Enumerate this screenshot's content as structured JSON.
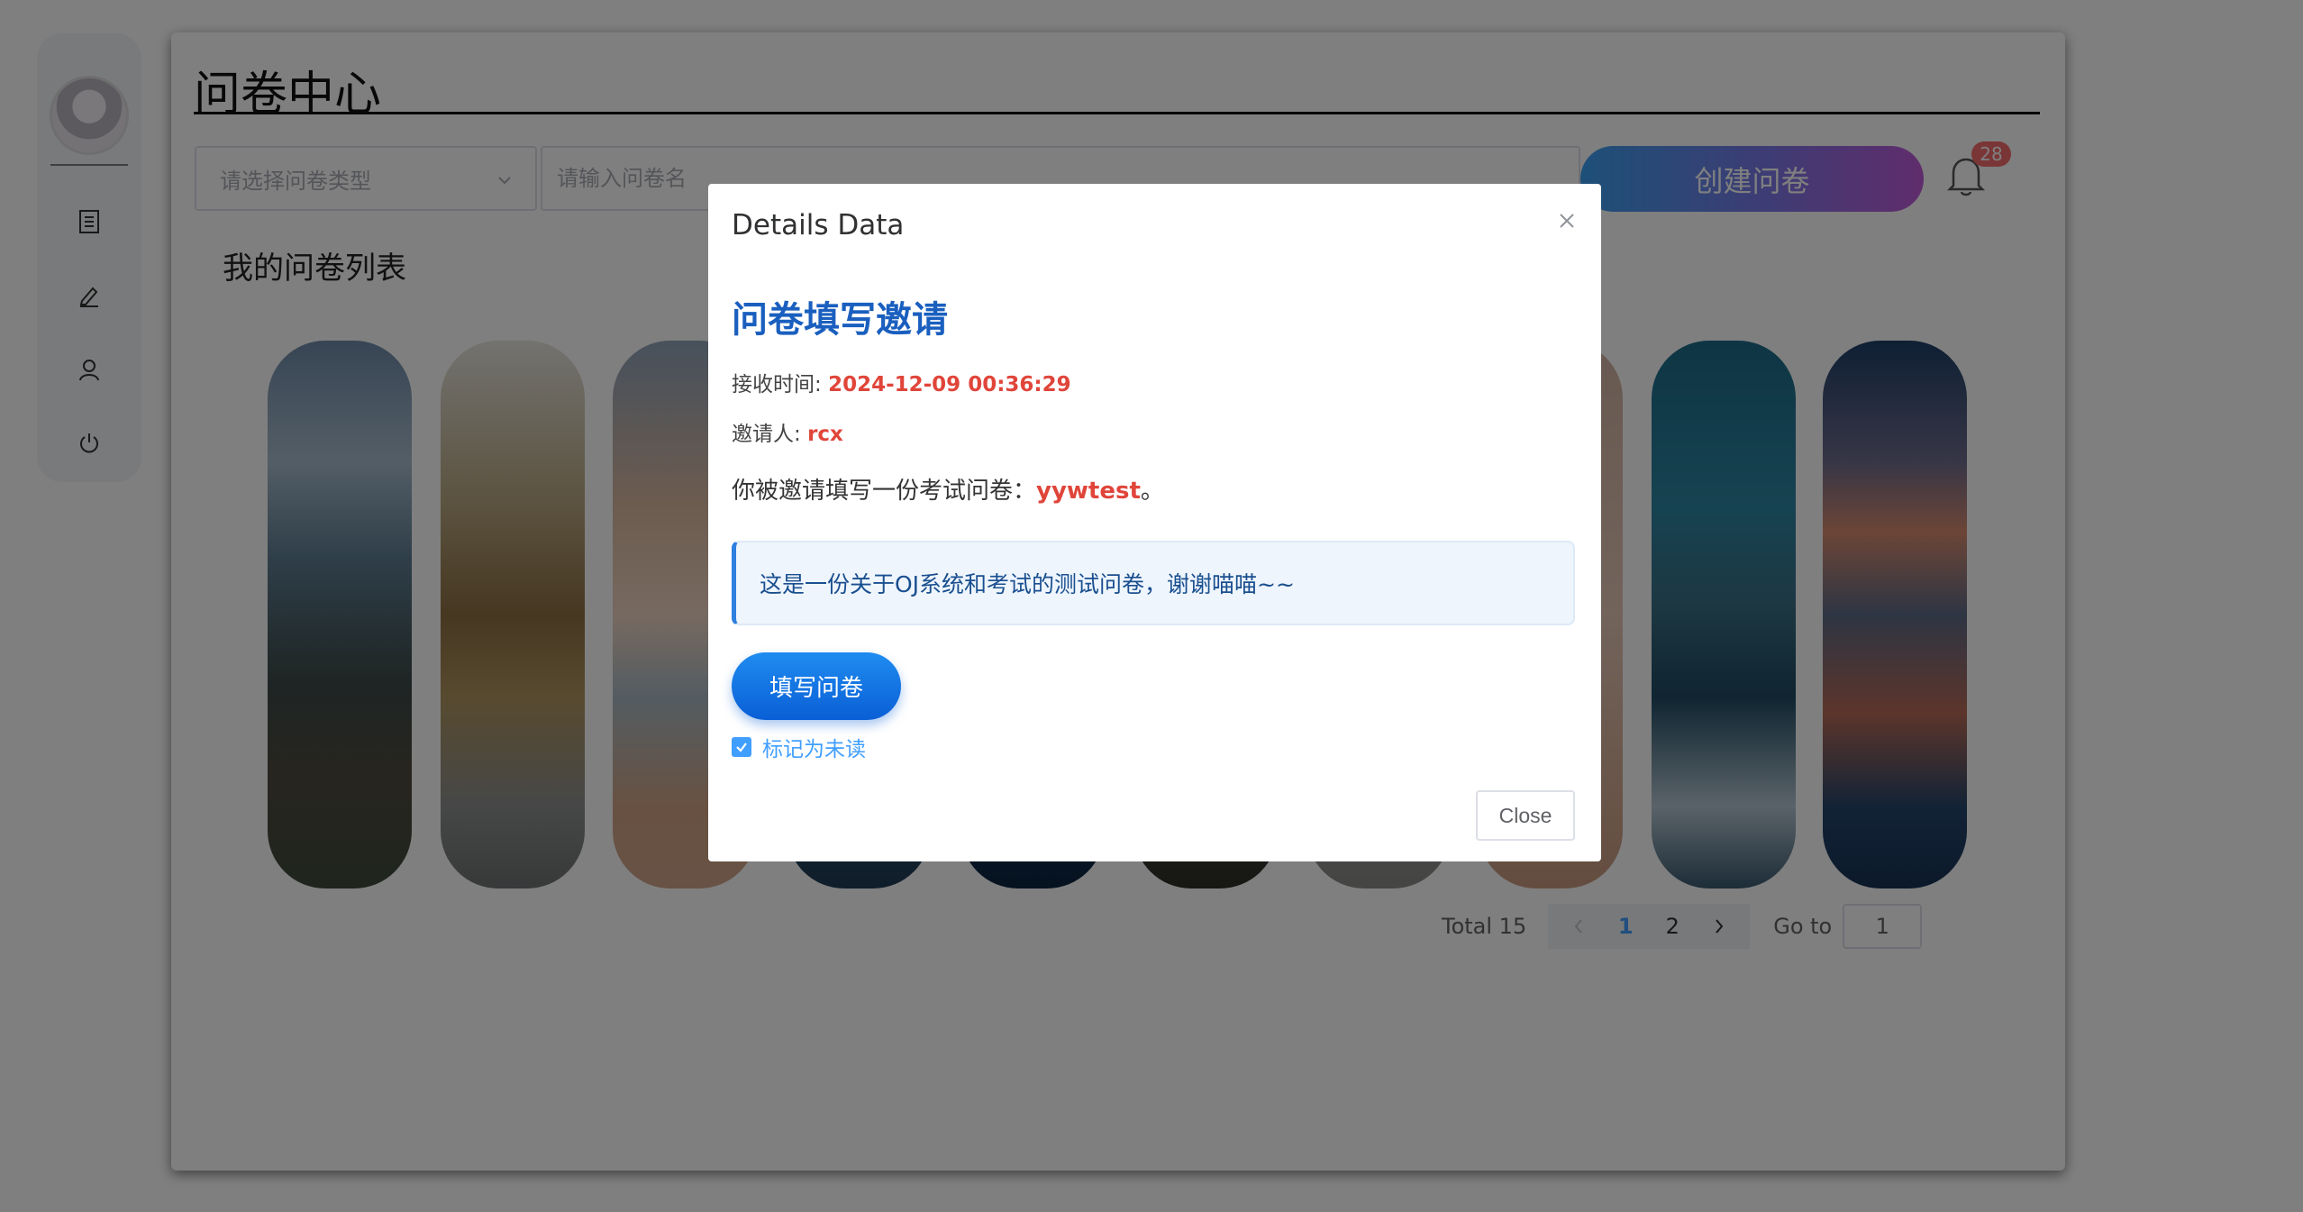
{
  "sidebar": {
    "avatar_alt": "avatar",
    "icons": [
      "document-icon",
      "edit-pen-icon",
      "user-icon",
      "power-icon"
    ]
  },
  "header": {
    "title": "问卷中心"
  },
  "filters": {
    "type_placeholder": "请选择问卷类型",
    "name_placeholder": "请输入问卷名",
    "create_label": "创建问卷"
  },
  "notifications": {
    "badge_count": "28"
  },
  "list": {
    "title": "我的问卷列表",
    "card_count": 10
  },
  "pagination": {
    "total_label": "Total 15",
    "pages": [
      "1",
      "2"
    ],
    "current_page": "1",
    "goto_label": "Go to",
    "goto_value": "1"
  },
  "dialog": {
    "title": "Details Data",
    "heading": "问卷填写邀请",
    "time_label": "接收时间: ",
    "time_value": "2024-12-09 00:36:29",
    "inviter_label": "邀请人: ",
    "inviter_value": "rcx",
    "desc_prefix": "你被邀请填写一份考试问卷：",
    "survey_name": "yywtest",
    "desc_suffix": "。",
    "note": "这是一份关于OJ系统和考试的测试问卷，谢谢喵喵~~",
    "fill_button": "填写问卷",
    "mark_unread_label": "标记为未读",
    "mark_unread_checked": true,
    "close_button": "Close"
  },
  "colors": {
    "accent_blue": "#409eff",
    "heading_blue": "#1a5fbf",
    "highlight_red": "#e0453a",
    "badge_red": "#f56c6c"
  }
}
